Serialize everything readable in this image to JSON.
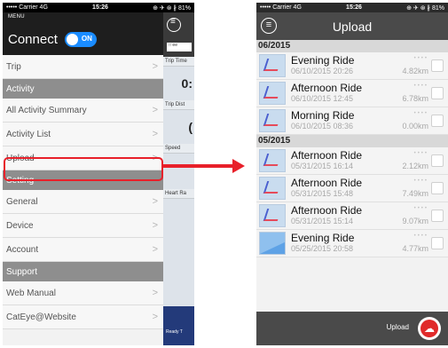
{
  "left": {
    "status": {
      "carrier": "••••• Carrier",
      "network": "4G",
      "time": "15:26",
      "icons": "⊕ ✈ ⊛ ∦ 81%",
      "battery_icon": "battery-icon"
    },
    "menu_label": "MENU",
    "connect_label": "Connect",
    "toggle_label": "ON",
    "items": [
      {
        "label": "Trip",
        "kind": "item"
      },
      {
        "label": "Activity",
        "kind": "section"
      },
      {
        "label": "All Activity Summary",
        "kind": "item"
      },
      {
        "label": "Activity List",
        "kind": "item"
      },
      {
        "label": "Upload",
        "kind": "item",
        "highlighted": true
      },
      {
        "label": "Setting",
        "kind": "section"
      },
      {
        "label": "General",
        "kind": "item"
      },
      {
        "label": "Device",
        "kind": "item"
      },
      {
        "label": "Account",
        "kind": "item"
      },
      {
        "label": "Support",
        "kind": "section"
      },
      {
        "label": "Web Manual",
        "kind": "item"
      },
      {
        "label": "CatEye@Website",
        "kind": "item"
      }
    ],
    "behind": {
      "tab_label": "□ ee",
      "trip_time_label": "Trip Time",
      "trip_time_value": "0:",
      "trip_dist_label": "Trip Dist",
      "trip_dist_value": "(",
      "speed_label": "Speed",
      "heart_label": "Heart Ra",
      "ready_label": "Ready T"
    },
    "chevron": ">"
  },
  "right": {
    "status": {
      "carrier": "••••• Carrier",
      "network": "4G",
      "time": "15:26",
      "icons": "⊕ ✈ ⊛ ∦ 81%",
      "battery_icon": "battery-icon"
    },
    "title": "Upload",
    "menu_icon": "≡",
    "groups": [
      {
        "month": "06/2015",
        "rides": [
          {
            "name": "Evening Ride",
            "date": "06/10/2015 20:26",
            "distance": "4.82km",
            "thumb": "map"
          },
          {
            "name": "Afternoon Ride",
            "date": "06/10/2015 12:45",
            "distance": "6.78km",
            "thumb": "map"
          },
          {
            "name": "Morning Ride",
            "date": "06/10/2015 08:36",
            "distance": "0.00km",
            "thumb": "map"
          }
        ]
      },
      {
        "month": "05/2015",
        "rides": [
          {
            "name": "Afternoon Ride",
            "date": "05/31/2015 16:14",
            "distance": "2.12km",
            "thumb": "map"
          },
          {
            "name": "Afternoon Ride",
            "date": "05/31/2015 15:48",
            "distance": "7.49km",
            "thumb": "map"
          },
          {
            "name": "Afternoon Ride",
            "date": "05/31/2015 15:14",
            "distance": "9.07km",
            "thumb": "map"
          },
          {
            "name": "Evening Ride",
            "date": "05/25/2015 20:58",
            "distance": "4.77km",
            "thumb": "plain"
          }
        ]
      }
    ],
    "upload_label": "Upload",
    "upload_icon": "cloud-upload-icon"
  },
  "colors": {
    "highlight": "#e8202a",
    "toggle": "#1a8cff",
    "upload_button": "#e02a2a"
  }
}
